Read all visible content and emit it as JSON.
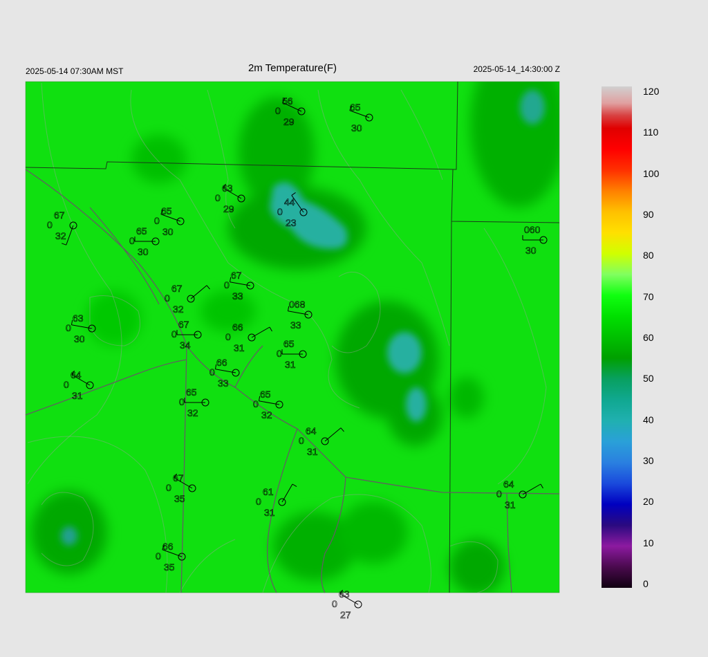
{
  "header": {
    "local_time": "2025-05-14 07:30AM MST",
    "title": "2m Temperature(F)",
    "utc_time": "2025-05-14_14:30:00 Z"
  },
  "colorbar": {
    "ticks": [
      120,
      110,
      100,
      90,
      80,
      70,
      60,
      50,
      40,
      30,
      20,
      10,
      0
    ],
    "stops": [
      {
        "v": 0,
        "c": "#100010"
      },
      {
        "v": 5,
        "c": "#4a0a4e"
      },
      {
        "v": 10,
        "c": "#8c1aa0"
      },
      {
        "v": 15,
        "c": "#2a0a80"
      },
      {
        "v": 20,
        "c": "#0000c0"
      },
      {
        "v": 25,
        "c": "#1a4adc"
      },
      {
        "v": 30,
        "c": "#2a80e0"
      },
      {
        "v": 35,
        "c": "#2aa0d8"
      },
      {
        "v": 40,
        "c": "#20b0b0"
      },
      {
        "v": 45,
        "c": "#10a890"
      },
      {
        "v": 50,
        "c": "#08a060"
      },
      {
        "v": 55,
        "c": "#00a000"
      },
      {
        "v": 60,
        "c": "#00c000"
      },
      {
        "v": 65,
        "c": "#00e000"
      },
      {
        "v": 70,
        "c": "#10ff10"
      },
      {
        "v": 75,
        "c": "#80ff60"
      },
      {
        "v": 80,
        "c": "#d0ff00"
      },
      {
        "v": 85,
        "c": "#ffe000"
      },
      {
        "v": 90,
        "c": "#ffc000"
      },
      {
        "v": 95,
        "c": "#ff8000"
      },
      {
        "v": 100,
        "c": "#ff3000"
      },
      {
        "v": 105,
        "c": "#ff0000"
      },
      {
        "v": 110,
        "c": "#e00000"
      },
      {
        "v": 113,
        "c": "#d84040"
      },
      {
        "v": 116,
        "c": "#e0a0a0"
      },
      {
        "v": 120,
        "c": "#d0d0d0"
      }
    ]
  },
  "stations": [
    {
      "t": "56",
      "d": "29",
      "s": "0"
    },
    {
      "t": "65",
      "d": "30",
      "s": ""
    },
    {
      "t": "63",
      "d": "29",
      "s": "0"
    },
    {
      "t": "44",
      "d": "23",
      "s": "0"
    },
    {
      "t": "67",
      "d": "32",
      "s": "0"
    },
    {
      "t": "65",
      "d": "30",
      "s": "0"
    },
    {
      "t": "65",
      "d": "30",
      "s": "0"
    },
    {
      "t": "060",
      "d": "30",
      "s": ""
    },
    {
      "t": "67",
      "d": "33",
      "s": "0"
    },
    {
      "t": "67",
      "d": "32",
      "s": "0"
    },
    {
      "t": "068",
      "d": "33",
      "s": ""
    },
    {
      "t": "63",
      "d": "30",
      "s": "0"
    },
    {
      "t": "66",
      "d": "31",
      "s": "0"
    },
    {
      "t": "67",
      "d": "34",
      "s": "0"
    },
    {
      "t": "65",
      "d": "31",
      "s": "0"
    },
    {
      "t": "66",
      "d": "33",
      "s": "0"
    },
    {
      "t": "64",
      "d": "31",
      "s": "0"
    },
    {
      "t": "65",
      "d": "32",
      "s": "0"
    },
    {
      "t": "65",
      "d": "32",
      "s": "0"
    },
    {
      "t": "64",
      "d": "31",
      "s": "0"
    },
    {
      "t": "67",
      "d": "35",
      "s": "0"
    },
    {
      "t": "61",
      "d": "31",
      "s": "0"
    },
    {
      "t": "64",
      "d": "31",
      "s": "0"
    },
    {
      "t": "66",
      "d": "35",
      "s": "0"
    },
    {
      "t": "63",
      "d": "27",
      "s": "0"
    }
  ]
}
